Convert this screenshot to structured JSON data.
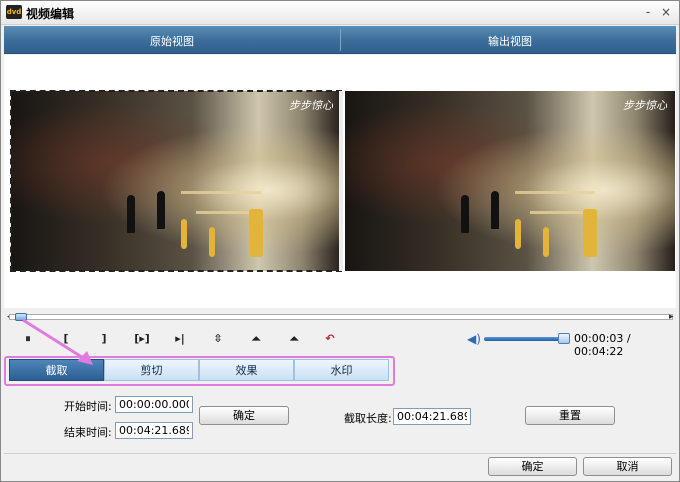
{
  "window": {
    "title": "视频编辑",
    "minimize": "-",
    "close": "×"
  },
  "views": {
    "source_label": "原始视图",
    "output_label": "输出视图",
    "watermark": "步步惊心"
  },
  "timeline": {
    "position_fraction": 0.012
  },
  "player": {
    "controls": [
      "⏸",
      "[",
      "]",
      "[▸]",
      "▸|",
      "⇳",
      "⏶",
      "⏶",
      "↶"
    ],
    "volume_fraction": 0.9,
    "time_display": "00:00:03 / 00:04:22"
  },
  "tabs": [
    "截取",
    "剪切",
    "效果",
    "水印"
  ],
  "active_tab": 0,
  "trim": {
    "start_label": "开始时间:",
    "start_value": "00:00:00.000",
    "end_label": "结束时间:",
    "end_value": "00:04:21.689",
    "confirm_label": "确定",
    "length_label": "截取长度:",
    "length_value": "00:04:21.689",
    "reset_label": "重置"
  },
  "footer": {
    "ok_label": "确定",
    "cancel_label": "取消"
  },
  "colors": {
    "header_blue": "#3e6f9c",
    "highlight_pink": "#e07be0",
    "tab_active": "#2b5f94"
  }
}
